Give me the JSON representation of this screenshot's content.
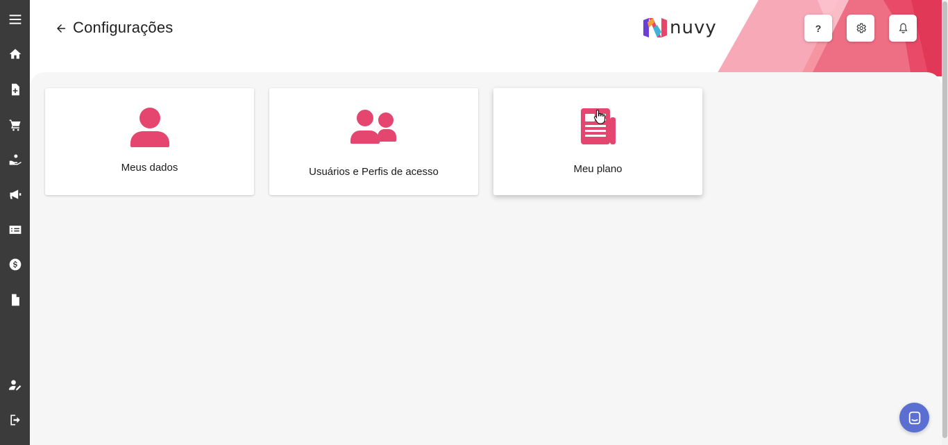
{
  "sidebar": {
    "items": [
      {
        "name": "menu-icon"
      },
      {
        "name": "home-icon"
      },
      {
        "name": "document-add-icon"
      },
      {
        "name": "cart-icon"
      },
      {
        "name": "hand-coin-icon"
      },
      {
        "name": "megaphone-icon"
      },
      {
        "name": "money-card-icon"
      },
      {
        "name": "dollar-circle-icon"
      },
      {
        "name": "file-icon"
      },
      {
        "name": "user-edit-icon"
      },
      {
        "name": "logout-icon"
      }
    ]
  },
  "header": {
    "title": "Configurações",
    "logo_text": "nuvy",
    "help_label": "?"
  },
  "cards": [
    {
      "label": "Meus dados",
      "icon": "user-icon"
    },
    {
      "label": "Usuários e Perfis de acesso",
      "icon": "users-icon"
    },
    {
      "label": "Meu plano",
      "icon": "newspaper-icon"
    }
  ],
  "colors": {
    "accent": "#e5466f",
    "sidebar": "#3b3b3b",
    "chat": "#5a6fd0"
  }
}
